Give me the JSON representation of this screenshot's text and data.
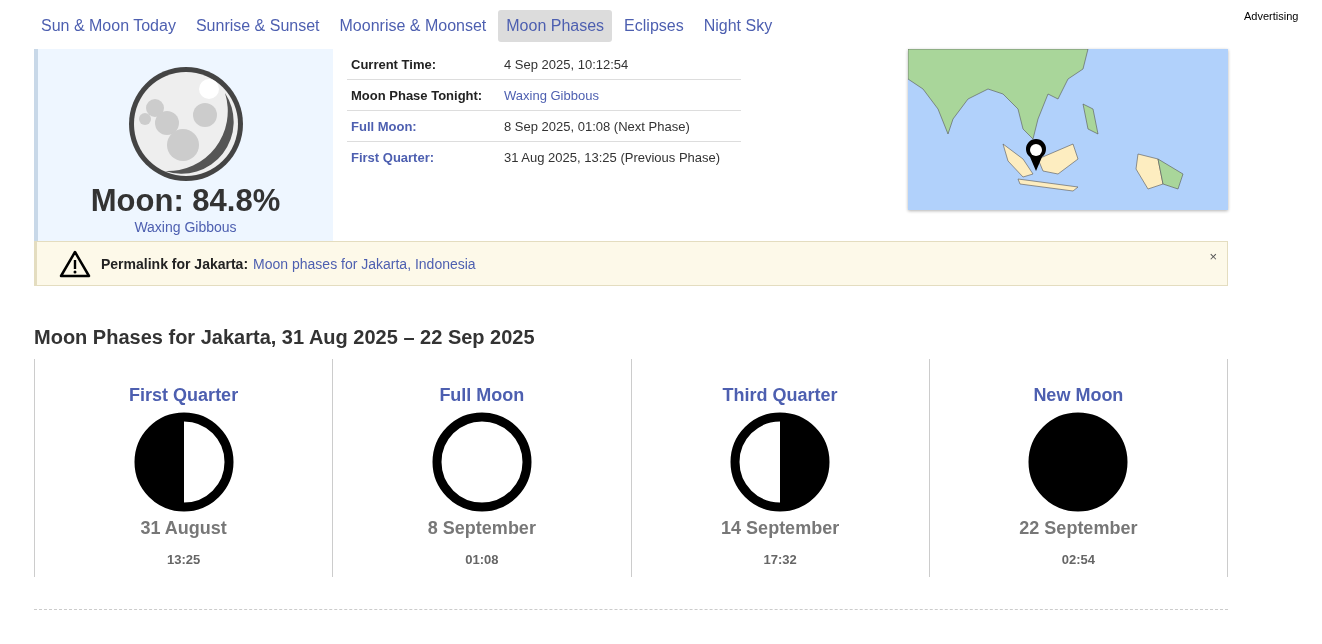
{
  "tabs": [
    {
      "label": "Sun & Moon Today",
      "selected": false
    },
    {
      "label": "Sunrise & Sunset",
      "selected": false
    },
    {
      "label": "Moonrise & Moonset",
      "selected": false
    },
    {
      "label": "Moon Phases",
      "selected": true
    },
    {
      "label": "Eclipses",
      "selected": false
    },
    {
      "label": "Night Sky",
      "selected": false
    }
  ],
  "advertising": "Advertising",
  "moon_summary": {
    "illumination": "Moon: 84.8%",
    "phase": "Waxing Gibbous"
  },
  "info_rows": [
    {
      "label": "Current Time:",
      "label_is_link": false,
      "value": "4 Sep 2025, 10:12:54",
      "value_is_link": false
    },
    {
      "label": "Moon Phase Tonight:",
      "label_is_link": false,
      "value": "Waxing Gibbous",
      "value_is_link": true
    },
    {
      "label": "Full Moon:",
      "label_is_link": true,
      "value": "8 Sep 2025, 01:08 (Next Phase)",
      "value_is_link": false
    },
    {
      "label": "First Quarter:",
      "label_is_link": true,
      "value": "31 Aug 2025, 13:25 (Previous Phase)",
      "value_is_link": false
    }
  ],
  "permalink": {
    "label": "Permalink for Jakarta:",
    "link": "Moon phases for Jakarta, Indonesia",
    "close": "×"
  },
  "section_title": "Moon Phases for Jakarta, 31 Aug 2025 – 22 Sep 2025",
  "phases": [
    {
      "kind": "first_quarter",
      "name": "First Quarter",
      "date": "31 August",
      "time": "13:25"
    },
    {
      "kind": "full",
      "name": "Full Moon",
      "date": "8 September",
      "time": "01:08"
    },
    {
      "kind": "third_quarter",
      "name": "Third Quarter",
      "date": "14 September",
      "time": "17:32"
    },
    {
      "kind": "new",
      "name": "New Moon",
      "date": "22 September",
      "time": "02:54"
    }
  ]
}
